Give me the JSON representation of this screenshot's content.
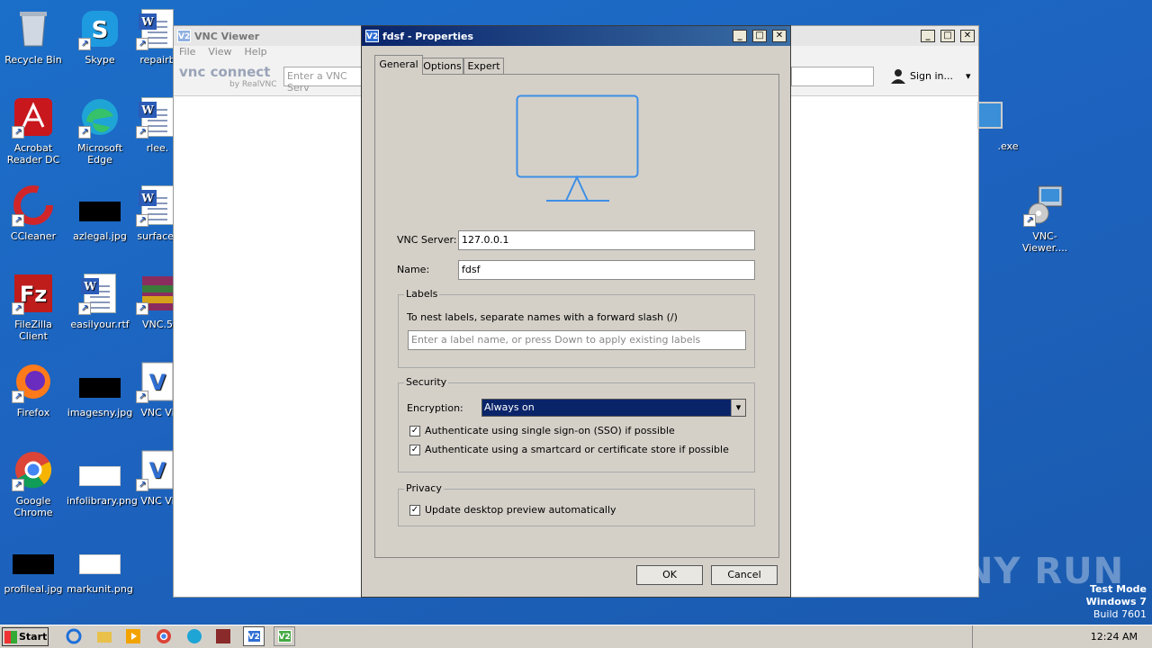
{
  "desktop": {
    "col1": [
      {
        "label": "Recycle Bin",
        "icon": "recycle-bin-icon"
      },
      {
        "label": "Acrobat Reader DC",
        "icon": "acrobat-icon"
      },
      {
        "label": "CCleaner",
        "icon": "ccleaner-icon"
      },
      {
        "label": "FileZilla Client",
        "icon": "filezilla-icon"
      },
      {
        "label": "Firefox",
        "icon": "firefox-icon"
      },
      {
        "label": "Google Chrome",
        "icon": "chrome-icon"
      },
      {
        "label": "profileal.jpg",
        "icon": "image-file-icon"
      }
    ],
    "col2": [
      {
        "label": "Skype",
        "icon": "skype-icon"
      },
      {
        "label": "Microsoft Edge",
        "icon": "edge-icon"
      },
      {
        "label": "azlegal.jpg",
        "icon": "image-file-icon"
      },
      {
        "label": "easilyour.rtf",
        "icon": "word-doc-icon"
      },
      {
        "label": "imagesny.jpg",
        "icon": "image-file-icon"
      },
      {
        "label": "infolibrary.png",
        "icon": "image-file-icon"
      },
      {
        "label": "markunit.png",
        "icon": "image-file-icon"
      }
    ],
    "col3": [
      {
        "label": "repairb",
        "icon": "word-doc-icon"
      },
      {
        "label": "rlee.",
        "icon": "word-doc-icon"
      },
      {
        "label": "surfacer",
        "icon": "word-doc-icon"
      },
      {
        "label": "VNC.5",
        "icon": "winrar-icon"
      },
      {
        "label": "VNC Vi",
        "icon": "vnc-viewer-icon"
      },
      {
        "label": "VNC Vi",
        "icon": "vnc-viewer-icon"
      }
    ],
    "right": [
      {
        "label": ".exe",
        "icon": "installer-icon"
      },
      {
        "label": "VNC-Viewer....",
        "icon": "installer-icon"
      }
    ]
  },
  "vnc_viewer": {
    "title": "VNC Viewer",
    "menu": [
      "File",
      "View",
      "Help"
    ],
    "logo": "vnc connect",
    "logo_sub": "by RealVNC",
    "search_placeholder": "Enter a VNC Serv",
    "sign_in": "Sign in..."
  },
  "dialog": {
    "title": "fdsf - Properties",
    "tabs": [
      "General",
      "Options",
      "Expert"
    ],
    "vnc_server_label": "VNC Server:",
    "vnc_server_value": "127.0.0.1",
    "name_label": "Name:",
    "name_value": "fdsf",
    "labels_group": "Labels",
    "labels_hint": "To nest labels, separate names with a forward slash (/)",
    "labels_placeholder": "Enter a label name, or press Down to apply existing labels",
    "security_group": "Security",
    "encryption_label": "Encryption:",
    "encryption_value": "Always on",
    "sso_label": "Authenticate using single sign-on (SSO) if possible",
    "smartcard_label": "Authenticate using a smartcard or certificate store if possible",
    "privacy_group": "Privacy",
    "preview_label": "Update desktop preview automatically",
    "ok": "OK",
    "cancel": "Cancel"
  },
  "watermark": {
    "brand": "ANY RUN",
    "line1": "Test Mode",
    "line2": "Windows 7",
    "line3": "Build 7601"
  },
  "taskbar": {
    "start": "Start",
    "time": "12:24 AM"
  }
}
